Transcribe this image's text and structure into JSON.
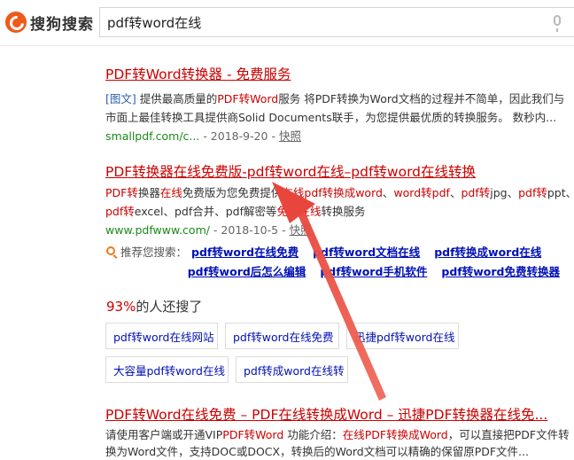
{
  "header": {
    "logo_text": "搜狗搜索",
    "query": "pdf转word在线"
  },
  "results": [
    {
      "title_parts": [
        {
          "text": "PDF转Word转换器",
          "hl": true
        },
        {
          "text": " - 免费服务",
          "hl": false
        }
      ],
      "snippet_lines": [
        [
          {
            "text": "[图文]",
            "style": "tag"
          },
          {
            "text": " 提供最高质量的",
            "style": ""
          },
          {
            "text": "PDF转Word",
            "style": "hl"
          },
          {
            "text": "服务 将PDF转换为Word文档的过程并不简单，因此我们与",
            "style": ""
          }
        ],
        [
          {
            "text": "市面上最佳转换工具提供商Solid Documents联手，为您提供最优质的转换服务。 数秒内...",
            "style": ""
          }
        ]
      ],
      "url": "smallpdf.com/c...",
      "date": " - 2018-9-20 - ",
      "snapshot": "快照"
    },
    {
      "title_parts": [
        {
          "text": "PDF转换器在线免费版-pdf转word在线–pdf转word在线转换",
          "hl": true
        }
      ],
      "snippet_lines": [
        [
          {
            "text": "PDF",
            "style": "hl"
          },
          {
            "text": "转",
            "style": ""
          },
          {
            "text": "换器",
            "style": ""
          },
          {
            "text": "在线",
            "style": "hl"
          },
          {
            "text": "免费版为您免费提供",
            "style": ""
          },
          {
            "text": "在线pdf转换成word",
            "style": "hl"
          },
          {
            "text": "、",
            "style": ""
          },
          {
            "text": "word转pdf",
            "style": "hl"
          },
          {
            "text": "、",
            "style": ""
          },
          {
            "text": "pdf转",
            "style": "hl"
          },
          {
            "text": "jpg、",
            "style": ""
          },
          {
            "text": "pdf转",
            "style": "hl"
          },
          {
            "text": "ppt、",
            "style": ""
          }
        ],
        [
          {
            "text": "pdf转",
            "style": "hl"
          },
          {
            "text": "excel、pdf合并、pdf解密等",
            "style": ""
          },
          {
            "text": "免费在线",
            "style": "hl"
          },
          {
            "text": "转换服务",
            "style": ""
          }
        ]
      ],
      "url": "www.pdfwww.com/",
      "date": " - 2018-10-5 - ",
      "snapshot": "快照"
    },
    {
      "title_parts": [
        {
          "text": "PDF转Word在线",
          "hl": true
        },
        {
          "text": "免费",
          "hl": true
        },
        {
          "text": " – PDF在线转换成Word – 迅捷PDF转换器在线免...",
          "hl": false
        }
      ],
      "snippet_lines": [
        [
          {
            "text": "请使用客户端或开通VIP",
            "style": ""
          },
          {
            "text": "PDF转Word",
            "style": "hl"
          },
          {
            "text": " 功能介绍：",
            "style": ""
          },
          {
            "text": "在线PDF转换成Word",
            "style": "hl"
          },
          {
            "text": "，可以直接把PDF文件转",
            "style": ""
          }
        ],
        [
          {
            "text": "换为Word文件，支持DOC或DOCX，转换后的Word文档可以精确的保留原PDF文件...",
            "style": ""
          }
        ]
      ]
    }
  ],
  "recommend": {
    "label": "推荐您搜索：",
    "row1": [
      "pdf转word在线免费",
      "pdf转word文档在线",
      "pdf转换成word在线"
    ],
    "row2": [
      "pdf转word后怎么编辑",
      "pdf转word手机软件",
      "pdf转word免费转换器"
    ]
  },
  "also_searched": {
    "percent": "93%",
    "text": "的人还搜了",
    "chips": [
      "pdf转word在线网站",
      "pdf转word在线免费",
      "迅捷pdf转word在线",
      "大容量pdf转word在线",
      "pdf转成word在线转"
    ]
  },
  "colors": {
    "highlight": "#cc0000",
    "link": "#0010b4",
    "url": "#1a8a1a",
    "annotation_arrow": "#e8463c"
  },
  "icons": [
    "sogou-logo-icon",
    "microphone-icon",
    "magnifier-icon",
    "annotation-arrow"
  ]
}
